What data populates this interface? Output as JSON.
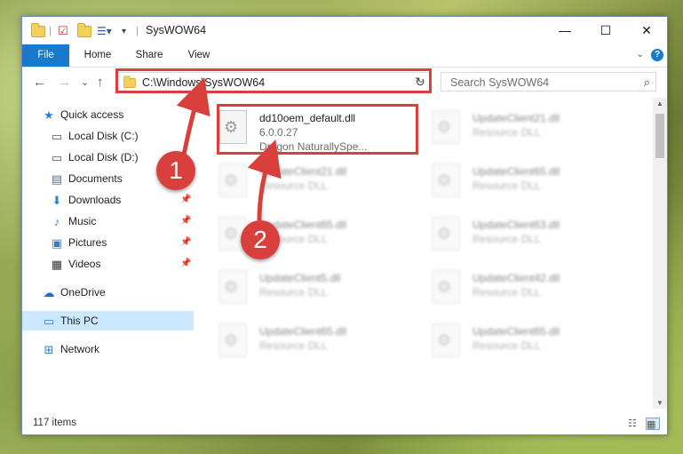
{
  "window": {
    "title": "SysWOW64",
    "controls": {
      "minimize": "—",
      "maximize": "☐",
      "close": "✕"
    }
  },
  "ribbon": {
    "tabs": [
      "File",
      "Home",
      "Share",
      "View"
    ]
  },
  "nav": {
    "back": "←",
    "forward": "→",
    "recent": "⌄",
    "up": "↑"
  },
  "address": {
    "path": "C:\\Windows\\SysWOW64",
    "refresh": "↻"
  },
  "search": {
    "placeholder": "Search SysWOW64",
    "icon": "search-icon"
  },
  "sidebar": {
    "items": [
      {
        "label": "Quick access",
        "icon": "star-icon"
      },
      {
        "label": "Local Disk (C:)",
        "icon": "drive-icon"
      },
      {
        "label": "Local Disk (D:)",
        "icon": "drive-icon"
      },
      {
        "label": "Documents",
        "icon": "documents-icon"
      },
      {
        "label": "Downloads",
        "icon": "download-icon"
      },
      {
        "label": "Music",
        "icon": "music-icon"
      },
      {
        "label": "Pictures",
        "icon": "pictures-icon"
      },
      {
        "label": "Videos",
        "icon": "videos-icon"
      },
      {
        "label": "OneDrive",
        "icon": "cloud-icon"
      },
      {
        "label": "This PC",
        "icon": "computer-icon"
      },
      {
        "label": "Network",
        "icon": "network-icon"
      }
    ]
  },
  "files": [
    {
      "name": "dd10oem_default.dll",
      "version": "6.0.0.27",
      "description": "Dragon NaturallySpe..."
    },
    {
      "name": "UpdateClient21.dll",
      "description": "Resource DLL"
    },
    {
      "name": "UpdateClient21.dll",
      "description": "Resource DLL"
    },
    {
      "name": "UpdateClient65.dll",
      "description": "Resource DLL"
    },
    {
      "name": "UpdateClient65.dll",
      "description": "Resource DLL"
    },
    {
      "name": "UpdateClient63.dll",
      "description": "Resource DLL"
    },
    {
      "name": "UpdateClient5.dll",
      "description": "Resource DLL"
    },
    {
      "name": "UpdateClient42.dll",
      "description": "Resource DLL"
    },
    {
      "name": "UpdateClient65.dll",
      "description": "Resource DLL"
    },
    {
      "name": "UpdateClient65.dll",
      "description": "Resource DLL"
    }
  ],
  "status": {
    "item_count": "117 items"
  },
  "annotations": {
    "step1": "1",
    "step2": "2",
    "color": "#d9403d"
  }
}
